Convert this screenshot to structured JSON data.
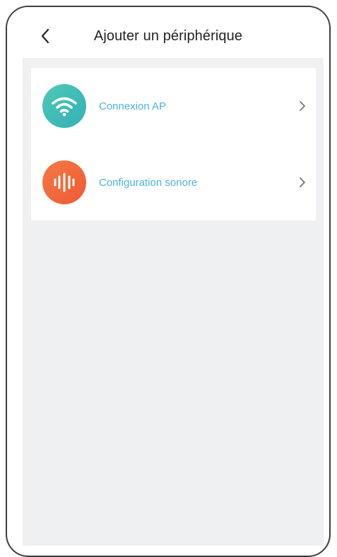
{
  "header": {
    "title": "Ajouter un périphérique",
    "back_icon": "chevron-left-icon"
  },
  "items": [
    {
      "label": "Connexion AP",
      "icon": "wifi-icon",
      "icon_color": "#3fbfae",
      "chevron_icon": "chevron-right-icon"
    },
    {
      "label": "Configuration sonore",
      "icon": "sound-wave-icon",
      "icon_color": "#f26b3a",
      "chevron_icon": "chevron-right-icon"
    }
  ],
  "colors": {
    "label": "#4eb0e4",
    "background": "#eff0f2",
    "card": "#ffffff"
  }
}
